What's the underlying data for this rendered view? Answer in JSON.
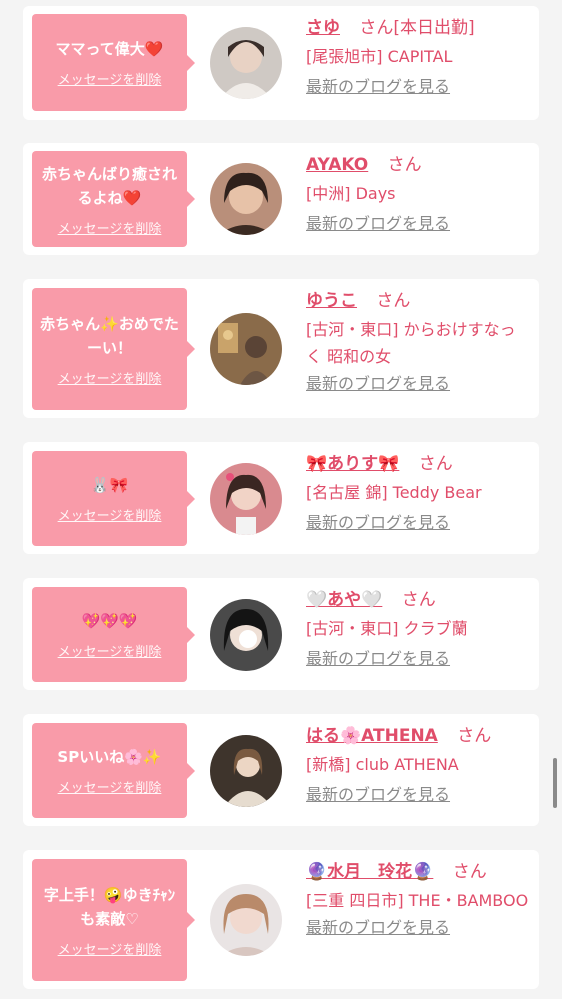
{
  "delete_label": "メッセージを削除",
  "san_label": "さん",
  "blog_label": "最新のブログを見る",
  "colors": {
    "accent": "#e04d6a",
    "bubble": "#f99ba9",
    "muted": "#8a8a8a",
    "background": "#f4f4f4"
  },
  "items": [
    {
      "message": "ママって偉大❤️",
      "name": "さゆ",
      "shop": "[尾張旭市] CAPITAL",
      "status": "[本日出勤]"
    },
    {
      "message": "赤ちゃんばり癒されるよね❤️",
      "name": "AYAKO",
      "shop": "[中洲] Days"
    },
    {
      "message": "赤ちゃん✨おめでたーい！",
      "name": "ゆうこ",
      "shop": "[古河・東口] からおけすなっく 昭和の女"
    },
    {
      "message": "🐰🎀",
      "name": "🎀ありす🎀",
      "shop": "[名古屋 錦] Teddy Bear"
    },
    {
      "message": "💖💖💖",
      "name": "🤍あや🤍",
      "shop": "[古河・東口] クラブ蘭"
    },
    {
      "message": "SPいいね🌸✨",
      "name": "はる🌸ATHENA",
      "shop": "[新橋] club ATHENA"
    },
    {
      "message": "字上手！🤪ゆきﾁｬﾝも素敵♡",
      "name": "🔮水月　玲花🔮",
      "shop": "[三重 四日市] THE・BAMBOO"
    }
  ]
}
